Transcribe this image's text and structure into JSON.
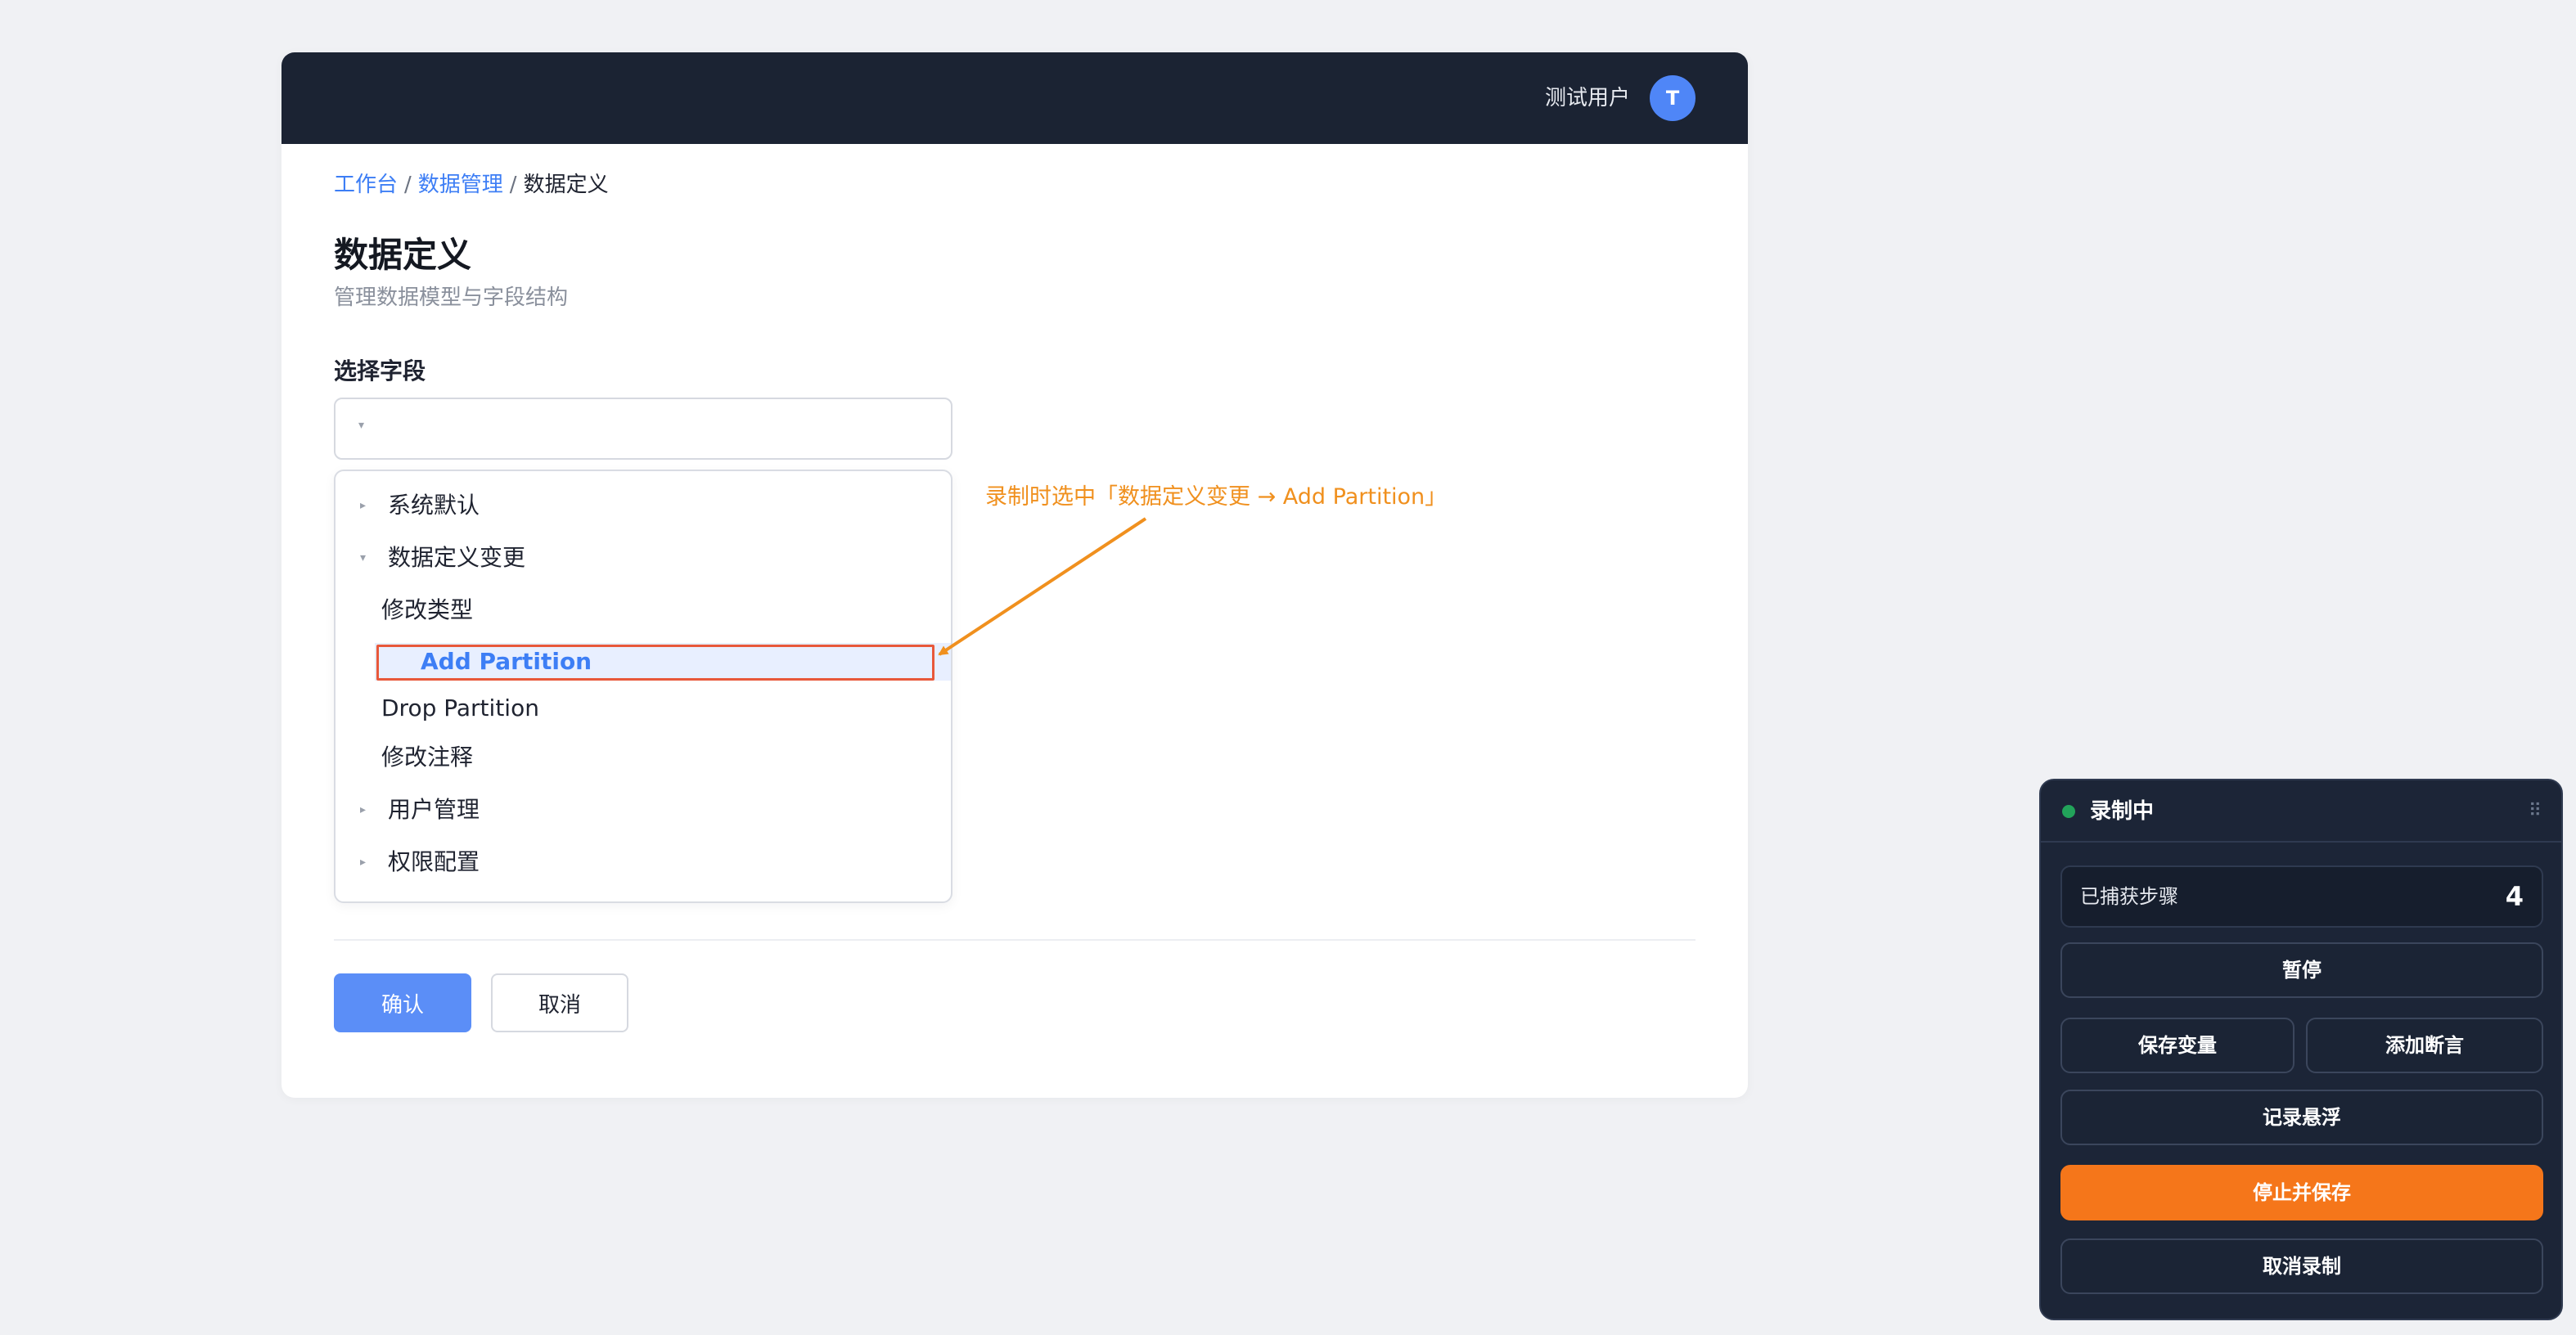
{
  "topbar": {
    "user_name": "测试用户",
    "avatar_initial": "T"
  },
  "breadcrumb": {
    "items": [
      "工作台",
      "数据管理",
      "数据定义"
    ],
    "separator": "/"
  },
  "page": {
    "title": "数据定义",
    "subtitle": "管理数据模型与字段结构"
  },
  "form": {
    "field_label": "选择字段",
    "select_value": "",
    "caret_glyph": "▾"
  },
  "dropdown": {
    "items": [
      {
        "label": "系统默认",
        "type": "group",
        "expanded": false
      },
      {
        "label": "数据定义变更",
        "type": "group",
        "expanded": true
      },
      {
        "label": "修改类型",
        "type": "option"
      },
      {
        "label": "Add Partition",
        "type": "option",
        "selected": true
      },
      {
        "label": "Drop Partition",
        "type": "option"
      },
      {
        "label": "修改注释",
        "type": "option"
      },
      {
        "label": "用户管理",
        "type": "group",
        "expanded": false
      },
      {
        "label": "权限配置",
        "type": "group",
        "expanded": false
      }
    ],
    "collapsed_glyph": "▸",
    "expanded_glyph": "▾"
  },
  "annotation": {
    "text": "录制时选中「数据定义变更 → Add Partition」",
    "color": "#f0901e",
    "highlight_color": "#e8583a"
  },
  "actions": {
    "confirm_label": "确认",
    "cancel_label": "取消"
  },
  "recorder": {
    "status_label": "录制中",
    "status_color": "#22a35a",
    "steps_label": "已捕获步骤",
    "steps_count": "4",
    "pause_label": "暂停",
    "save_variable_label": "保存变量",
    "add_assertion_label": "添加断言",
    "record_hover_label": "记录悬浮",
    "stop_save_label": "停止并保存",
    "cancel_recording_label": "取消录制",
    "drag_glyph": "⠿"
  },
  "colors": {
    "accent": "#3d7ef5",
    "primary_button": "#5b8ef7",
    "topbar_bg": "#1b2333",
    "recorder_bg": "#1c2537",
    "stop_button": "#f5761a"
  }
}
